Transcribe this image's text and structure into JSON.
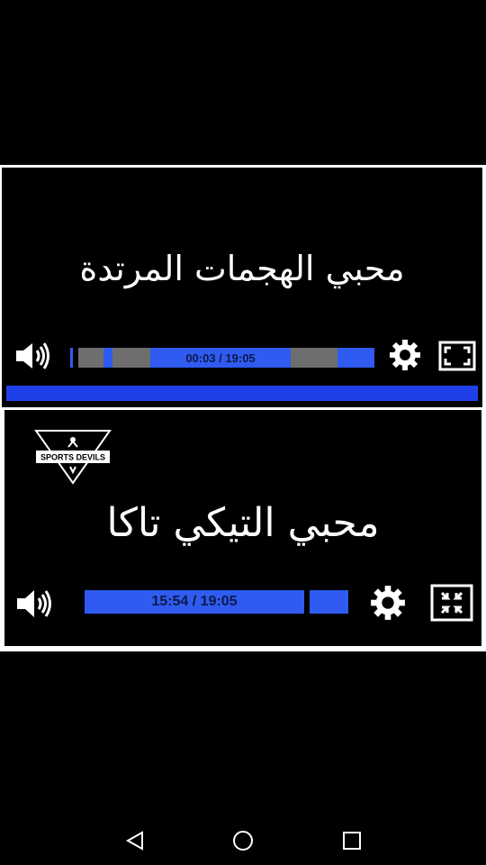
{
  "top_panel": {
    "caption": "محبي الهجمات المرتدة",
    "player": {
      "time_display": "00:03 / 19:05",
      "progress": 0.003,
      "volume_icon": "volume-icon",
      "settings_icon": "gear-icon",
      "fullscreen_icon": "expand-icon"
    }
  },
  "bottom_panel": {
    "logo_text": "SPORTS DEVILS",
    "caption": "محبي التيكي تاكا",
    "player": {
      "time_display": "15:54 / 19:05",
      "progress": 0.833,
      "volume_icon": "volume-icon",
      "settings_icon": "gear-icon",
      "fullscreen_icon": "collapse-icon"
    }
  },
  "nav_bar": {
    "back_icon": "back-triangle-icon",
    "home_icon": "home-circle-icon",
    "recents_icon": "recents-square-icon"
  },
  "colors": {
    "accent_blue": "#1f3fe8",
    "track_blue": "#2f5bf0",
    "track_gray": "#6e6e6e",
    "background": "#000000",
    "frame": "#ffffff"
  }
}
